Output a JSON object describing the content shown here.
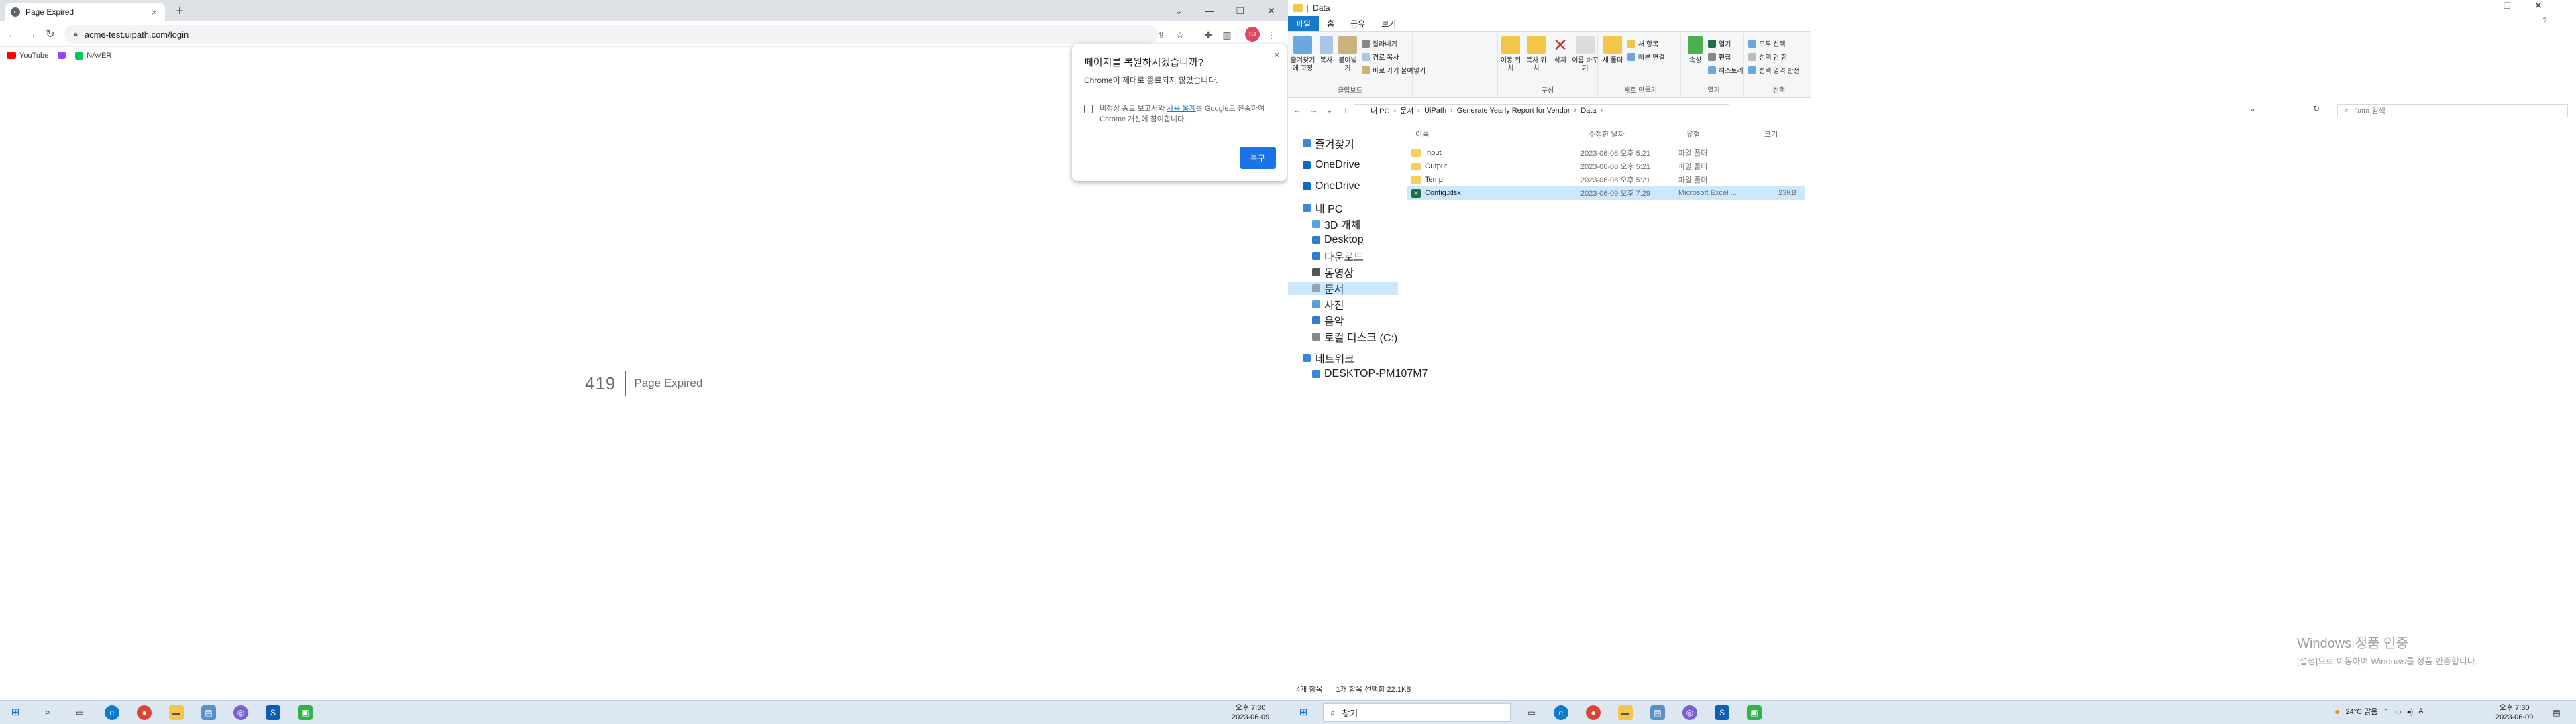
{
  "chrome": {
    "tab_title": "Page Expired",
    "new_tab": "+",
    "url": "acme-test.uipath.com/login",
    "avatar_initials": "SJ",
    "bookmarks": [
      "YouTube",
      "Twitch",
      "NAVER"
    ],
    "page": {
      "code": "419",
      "message": "Page Expired"
    },
    "restore_popup": {
      "title": "페이지를 복원하시겠습니까?",
      "body": "Chrome이 제대로 종료되지 않았습니다.",
      "checkbox_text_1": "비정상 종료 보고서와 ",
      "checkbox_link": "사용 통계",
      "checkbox_text_2": "를 Google로 전송하여 Chrome 개선에 참여합니다.",
      "button": "복구"
    }
  },
  "activation_watermark": {
    "title": "Windows 정품 인증",
    "subtitle": "[설정]으로 이동하여 Windows를 정품 인증합니다."
  },
  "explorer": {
    "window_title": "Data",
    "ribbon_tabs": [
      "파일",
      "홈",
      "공유",
      "보기"
    ],
    "ribbon": {
      "clipboard": {
        "pin": "즐겨찾기에 고정",
        "copy": "복사",
        "paste": "붙여넣기",
        "cut": "잘라내기",
        "copy_path": "경로 복사",
        "paste_shortcut": "바로 가기 붙여넣기",
        "group": "클립보드"
      },
      "organize": {
        "move": "이동 위치",
        "copyto": "복사 위치",
        "delete": "삭제",
        "rename": "이름 바꾸기",
        "group": "구성"
      },
      "new": {
        "new_folder": "새 폴더",
        "new_item": "새 항목",
        "easy_access": "빠른 연결",
        "group": "새로 만들기"
      },
      "open": {
        "properties": "속성",
        "open": "열기",
        "edit": "편집",
        "history": "히스토리",
        "group": "열기"
      },
      "select": {
        "all": "모두 선택",
        "none": "선택 안 함",
        "invert": "선택 영역 반전",
        "group": "선택"
      }
    },
    "breadcrumbs": [
      "내 PC",
      "문서",
      "UiPath",
      "Generate Yearly Report for Vendor",
      "Data"
    ],
    "search_placeholder": "Data 검색",
    "nav": [
      {
        "label": "즐겨찾기"
      },
      {
        "label": "OneDrive"
      },
      {
        "label": "OneDrive"
      },
      {
        "label": "내 PC"
      },
      {
        "label": "3D 개체"
      },
      {
        "label": "Desktop"
      },
      {
        "label": "다운로드"
      },
      {
        "label": "동영상"
      },
      {
        "label": "문서"
      },
      {
        "label": "사진"
      },
      {
        "label": "음악"
      },
      {
        "label": "로컬 디스크 (C:)"
      },
      {
        "label": "네트워크"
      },
      {
        "label": "DESKTOP-PM107M7"
      }
    ],
    "columns": [
      "이름",
      "수정한 날짜",
      "유형",
      "크기"
    ],
    "files": [
      {
        "name": "Input",
        "date": "2023-06-08 오후 5:21",
        "type": "파일 폴더",
        "size": ""
      },
      {
        "name": "Output",
        "date": "2023-06-08 오후 5:21",
        "type": "파일 폴더",
        "size": ""
      },
      {
        "name": "Temp",
        "date": "2023-06-08 오후 5:21",
        "type": "파일 폴더",
        "size": ""
      },
      {
        "name": "Config.xlsx",
        "date": "2023-06-09 오후 7:29",
        "type": "Microsoft Excel ...",
        "size": "23KB"
      }
    ],
    "status_count": "4개 항목",
    "status_selected": "1개 항목 선택함 22.1KB"
  },
  "taskbar_left": {
    "time": "오후 7:30",
    "date": "2023-06-09"
  },
  "taskbar_right": {
    "search_label": "찾기",
    "weather": "24°C 맑음",
    "ime": "A",
    "time": "오후 7:30",
    "date": "2023-06-09"
  }
}
